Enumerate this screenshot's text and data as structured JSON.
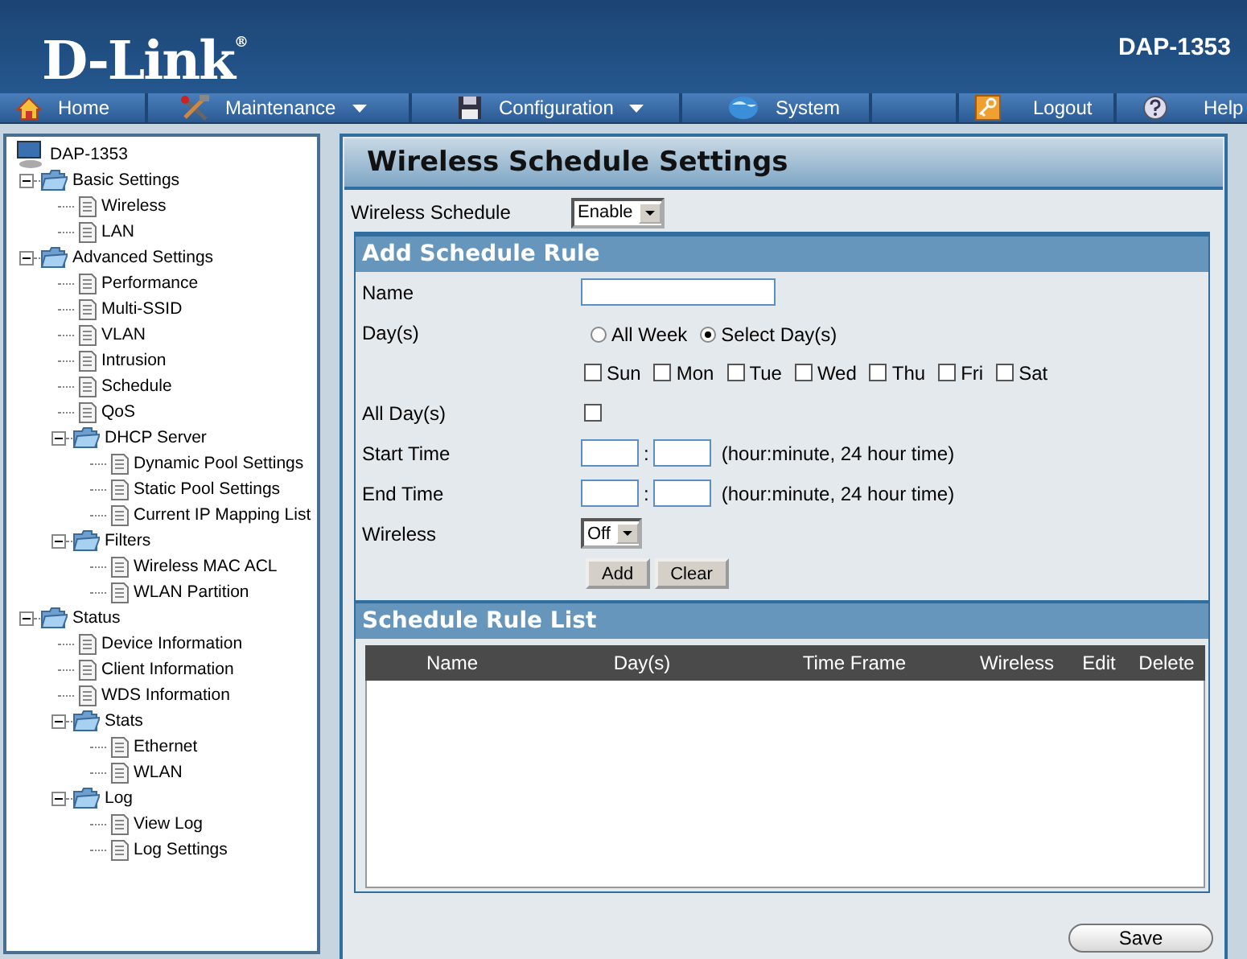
{
  "header": {
    "logo": "D-Link$^{®}$",
    "model": "DAP-1353"
  },
  "nav": [
    {
      "label": "Home",
      "dropdown": false
    },
    {
      "label": "Maintenance",
      "dropdown": true
    },
    {
      "label": "Configuration",
      "dropdown": true
    },
    {
      "label": "System",
      "dropdown": false
    },
    {
      "label": "Logout",
      "dropdown": false
    },
    {
      "label": "Help",
      "dropdown": false
    }
  ],
  "tree": [
    {
      "label": "DAP-1353",
      "kind": "device",
      "children": [
        {
          "label": "Basic Settings",
          "kind": "folder",
          "expanded": true,
          "children": [
            {
              "label": "Wireless",
              "kind": "page"
            },
            {
              "label": "LAN",
              "kind": "page"
            }
          ]
        },
        {
          "label": "Advanced Settings",
          "kind": "folder",
          "expanded": true,
          "children": [
            {
              "label": "Performance",
              "kind": "page"
            },
            {
              "label": "Multi-SSID",
              "kind": "page"
            },
            {
              "label": "VLAN",
              "kind": "page"
            },
            {
              "label": "Intrusion",
              "kind": "page"
            },
            {
              "label": "Schedule",
              "kind": "page"
            },
            {
              "label": "QoS",
              "kind": "page"
            },
            {
              "label": "DHCP Server",
              "kind": "folder",
              "expanded": true,
              "children": [
                {
                  "label": "Dynamic Pool Settings",
                  "kind": "page"
                },
                {
                  "label": "Static Pool Settings",
                  "kind": "page"
                },
                {
                  "label": "Current IP Mapping List",
                  "kind": "page"
                }
              ]
            },
            {
              "label": "Filters",
              "kind": "folder",
              "expanded": true,
              "children": [
                {
                  "label": "Wireless MAC ACL",
                  "kind": "page"
                },
                {
                  "label": "WLAN Partition",
                  "kind": "page"
                }
              ]
            }
          ]
        },
        {
          "label": "Status",
          "kind": "folder",
          "expanded": true,
          "children": [
            {
              "label": "Device Information",
              "kind": "page"
            },
            {
              "label": "Client Information",
              "kind": "page"
            },
            {
              "label": "WDS Information",
              "kind": "page"
            },
            {
              "label": "Stats",
              "kind": "folder",
              "expanded": true,
              "children": [
                {
                  "label": "Ethernet",
                  "kind": "page"
                },
                {
                  "label": "WLAN",
                  "kind": "page"
                }
              ]
            },
            {
              "label": "Log",
              "kind": "folder",
              "expanded": true,
              "children": [
                {
                  "label": "View Log",
                  "kind": "page"
                },
                {
                  "label": "Log Settings",
                  "kind": "page"
                }
              ]
            }
          ]
        }
      ]
    }
  ],
  "main": {
    "title": "Wireless Schedule Settings",
    "schedule": {
      "label": "Wireless Schedule",
      "value": "Enable"
    },
    "add_rule": {
      "heading": "Add Schedule Rule",
      "name_label": "Name",
      "days_label": "Day(s)",
      "day_modes": [
        {
          "label": "All Week",
          "selected": false
        },
        {
          "label": "Select Day(s)",
          "selected": true
        }
      ],
      "days": [
        {
          "label": "Sun",
          "checked": false
        },
        {
          "label": "Mon",
          "checked": false
        },
        {
          "label": "Tue",
          "checked": false
        },
        {
          "label": "Wed",
          "checked": false
        },
        {
          "label": "Thu",
          "checked": false
        },
        {
          "label": "Fri",
          "checked": false
        },
        {
          "label": "Sat",
          "checked": false
        }
      ],
      "all_days": {
        "label": "All Day(s)",
        "checked": false
      },
      "start_time": {
        "label": "Start Time",
        "separator": ":",
        "hint": "(hour:minute, 24 hour time)"
      },
      "end_time": {
        "label": "End Time",
        "separator": ":",
        "hint": "(hour:minute, 24 hour time)"
      },
      "wireless": {
        "label": "Wireless",
        "value": "Off"
      },
      "buttons": [
        "Add",
        "Clear"
      ]
    },
    "rule_list": {
      "heading": "Schedule Rule List",
      "columns": [
        "Name",
        "Day(s)",
        "Time Frame",
        "Wireless",
        "Edit",
        "Delete"
      ]
    },
    "save": "Save"
  }
}
